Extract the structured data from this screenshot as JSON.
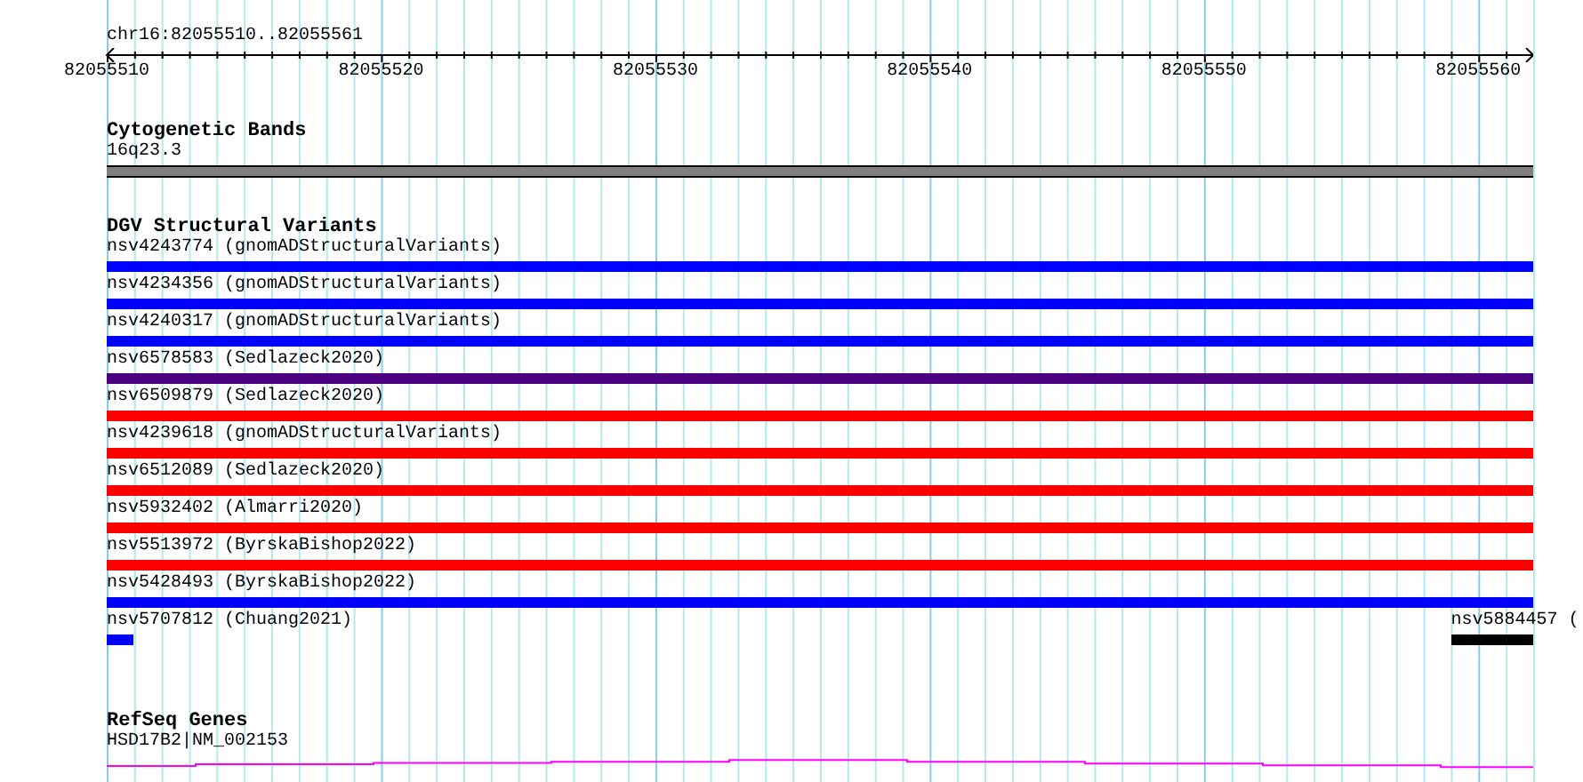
{
  "ruler": {
    "location": "chr16:82055510..82055561",
    "tick_labels": [
      "82055510",
      "82055520",
      "82055530",
      "82055540",
      "82055550",
      "82055560"
    ]
  },
  "cytogenetic_bands": {
    "title": "Cytogenetic Bands",
    "band": "16q23.3"
  },
  "dgv": {
    "title": "DGV Structural Variants",
    "rows": [
      {
        "features": [
          {
            "label": "nsv4243774 (gnomADStructuralVariants)",
            "color": "#0000ff",
            "kind": "full"
          }
        ]
      },
      {
        "features": [
          {
            "label": "nsv4234356 (gnomADStructuralVariants)",
            "color": "#0000ff",
            "kind": "full"
          }
        ]
      },
      {
        "features": [
          {
            "label": "nsv4240317 (gnomADStructuralVariants)",
            "color": "#0000ff",
            "kind": "full"
          }
        ]
      },
      {
        "features": [
          {
            "label": "nsv6578583 (Sedlazeck2020)",
            "color": "#4b0082",
            "kind": "full"
          }
        ]
      },
      {
        "features": [
          {
            "label": "nsv6509879 (Sedlazeck2020)",
            "color": "#ff0000",
            "kind": "full"
          }
        ]
      },
      {
        "features": [
          {
            "label": "nsv4239618 (gnomADStructuralVariants)",
            "color": "#ff0000",
            "kind": "full"
          }
        ]
      },
      {
        "features": [
          {
            "label": "nsv6512089 (Sedlazeck2020)",
            "color": "#ff0000",
            "kind": "full"
          }
        ]
      },
      {
        "features": [
          {
            "label": "nsv5932402 (Almarri2020)",
            "color": "#ff0000",
            "kind": "full"
          }
        ]
      },
      {
        "features": [
          {
            "label": "nsv5513972 (ByrskaBishop2022)",
            "color": "#ff0000",
            "kind": "full"
          }
        ]
      },
      {
        "features": [
          {
            "label": "nsv5428493 (ByrskaBishop2022)",
            "color": "#0000ff",
            "kind": "full"
          }
        ]
      },
      {
        "features": [
          {
            "label": "nsv5707812 (Chuang2021)",
            "color": "#0000ff",
            "kind": "start"
          },
          {
            "label": "nsv5884457 (",
            "color": "#000000",
            "kind": "end"
          }
        ]
      }
    ]
  },
  "refseq": {
    "title": "RefSeq Genes",
    "gene": "HSD17B2|NM_002153"
  }
}
